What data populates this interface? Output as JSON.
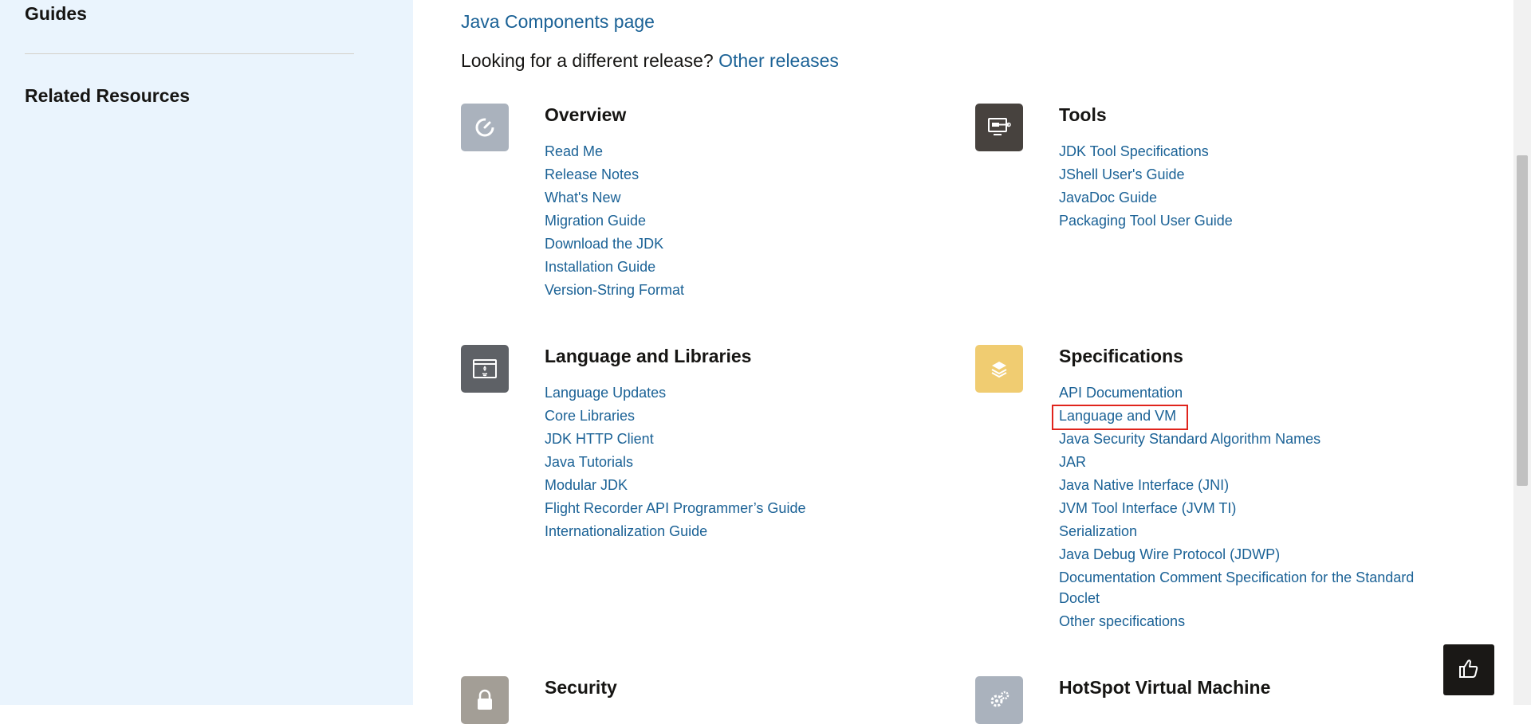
{
  "sidebar": {
    "guides_label": "Guides",
    "related_label": "Related Resources"
  },
  "main": {
    "components_link": "Java Components page",
    "release_question": "Looking for a different release?",
    "other_releases_link": "Other releases"
  },
  "sections": {
    "overview": {
      "title": "Overview",
      "icon": "dial-icon",
      "color": "#aab2bd",
      "links": [
        "Read Me",
        "Release Notes",
        "What's New",
        "Migration Guide",
        "Download the JDK",
        "Installation Guide",
        "Version-String Format"
      ]
    },
    "tools": {
      "title": "Tools",
      "icon": "monitor-key-icon",
      "color": "#47423e",
      "links": [
        "JDK Tool Specifications",
        "JShell User's Guide",
        "JavaDoc Guide",
        "Packaging Tool User Guide"
      ]
    },
    "language": {
      "title": "Language and Libraries",
      "icon": "java-window-icon",
      "color": "#5e6166",
      "links": [
        "Language Updates",
        "Core Libraries",
        "JDK HTTP Client",
        "Java Tutorials",
        "Modular JDK",
        "Flight Recorder API Programmer’s Guide",
        "Internationalization Guide"
      ]
    },
    "specs": {
      "title": "Specifications",
      "icon": "layers-icon",
      "color": "#f0cc71",
      "links": [
        "API Documentation",
        "Language and VM",
        "Java Security Standard Algorithm Names",
        "JAR",
        "Java Native Interface (JNI)",
        "JVM Tool Interface (JVM TI)",
        "Serialization",
        "Java Debug Wire Protocol (JDWP)",
        "Documentation Comment Specification for the Standard Doclet",
        "Other specifications"
      ]
    },
    "security": {
      "title": "Security",
      "icon": "lock-icon",
      "color": "#a39e96"
    },
    "hotspot": {
      "title": "HotSpot Virtual Machine",
      "icon": "gears-icon",
      "color": "#aab2bd"
    }
  },
  "colors": {
    "link": "#1b6296",
    "sidebar_bg": "#eaf4fd",
    "highlight": "#e0241c"
  },
  "feedback": {
    "icon": "thumbs-up-icon"
  }
}
